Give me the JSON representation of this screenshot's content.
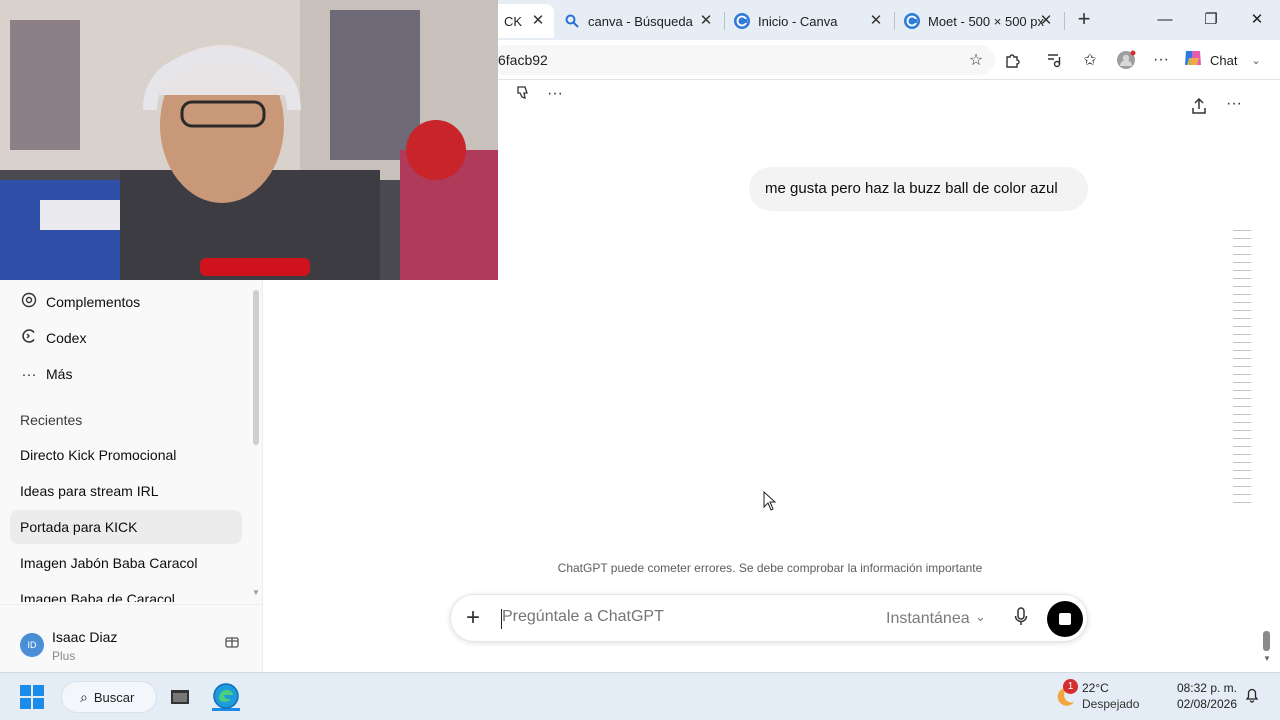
{
  "browser": {
    "tabs": [
      {
        "label": "CK",
        "icon": "chatgpt-icon"
      },
      {
        "label": "canva - Búsqueda",
        "icon": "search-icon"
      },
      {
        "label": "Inicio - Canva",
        "icon": "canva-icon"
      },
      {
        "label": "Moet - 500 × 500 px",
        "icon": "canva-icon"
      }
    ],
    "url": "6facb92",
    "copilot_label": "Chat"
  },
  "sidebar": {
    "items": [
      {
        "label": "Complementos",
        "icon": "apps-icon"
      },
      {
        "label": "Codex",
        "icon": "codex-icon"
      },
      {
        "label": "Más",
        "icon": "more-icon"
      }
    ],
    "recent_heading": "Recientes",
    "recents": [
      "Directo Kick Promocional",
      "Ideas para stream IRL",
      "Portada para KICK",
      "Imagen Jabón Baba Caracol",
      "Imagen Baba de Caracol"
    ],
    "selected_recent": "Portada para KICK",
    "user": {
      "initials": "ID",
      "name": "Isaac Diaz",
      "plan": "Plus"
    }
  },
  "chat": {
    "user_message": "me gusta pero haz la buzz ball de color azul",
    "disclaimer": "ChatGPT puede cometer errores. Se debe comprobar la información importante",
    "composer": {
      "placeholder": "Pregúntale a ChatGPT",
      "model": "Instantánea"
    }
  },
  "taskbar": {
    "search_label": "Buscar",
    "weather_temp": "22°C",
    "weather_desc": "Despejado",
    "weather_badge": "1",
    "time": "08:32 p. m.",
    "date": "02/08/2026"
  },
  "colors": {
    "accent": "#1d8bea",
    "stop_button": "#000000",
    "selected_row": "#ececec"
  }
}
